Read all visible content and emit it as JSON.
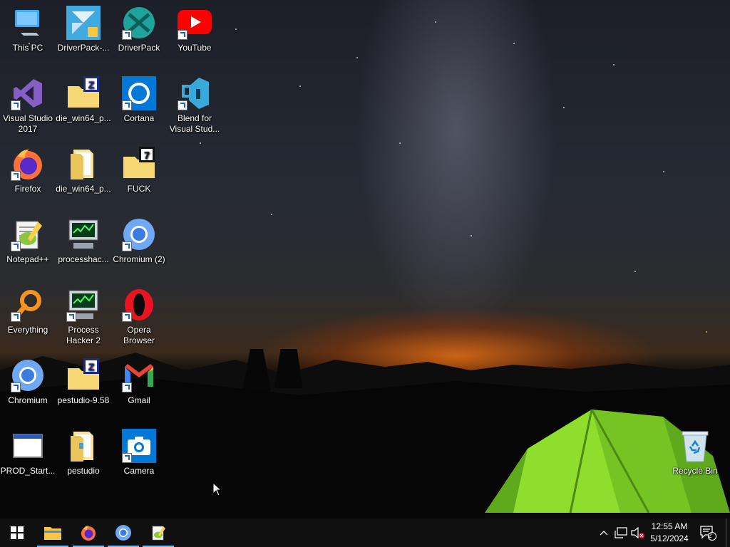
{
  "desktop": {
    "icons": [
      {
        "label": "This PC",
        "icon": "this-pc-icon"
      },
      {
        "label": "DriverPack-...",
        "icon": "driverpack-installer-icon"
      },
      {
        "label": "DriverPack",
        "icon": "driverpack-icon"
      },
      {
        "label": "YouTube",
        "icon": "youtube-icon"
      },
      {
        "label": "Visual Studio 2017",
        "icon": "visual-studio-icon"
      },
      {
        "label": "die_win64_p...",
        "icon": "zip-folder-icon"
      },
      {
        "label": "Cortana",
        "icon": "cortana-icon"
      },
      {
        "label": "Blend for Visual Stud...",
        "icon": "blend-icon"
      },
      {
        "label": "Firefox",
        "icon": "firefox-icon"
      },
      {
        "label": "die_win64_p...",
        "icon": "folder-icon"
      },
      {
        "label": "FUCK",
        "icon": "7zip-folder-icon"
      },
      {
        "label": "Notepad++",
        "icon": "notepad-plus-plus-icon"
      },
      {
        "label": "processhac...",
        "icon": "process-hacker-icon"
      },
      {
        "label": "Chromium (2)",
        "icon": "chromium-icon"
      },
      {
        "label": "Everything",
        "icon": "everything-icon"
      },
      {
        "label": "Process Hacker 2",
        "icon": "process-hacker-icon"
      },
      {
        "label": "Opera Browser",
        "icon": "opera-icon"
      },
      {
        "label": "Chromium",
        "icon": "chromium-icon"
      },
      {
        "label": "pestudio-9.58",
        "icon": "zip-folder-icon"
      },
      {
        "label": "Gmail",
        "icon": "gmail-icon"
      },
      {
        "label": "PROD_Start...",
        "icon": "window-app-icon"
      },
      {
        "label": "pestudio",
        "icon": "folder-icon"
      },
      {
        "label": "Camera",
        "icon": "camera-icon"
      },
      {
        "label": "Recycle Bin",
        "icon": "recycle-bin-icon"
      }
    ]
  },
  "taskbar": {
    "pinned": [
      {
        "name": "start-button",
        "icon": "windows-logo-icon"
      },
      {
        "name": "file-explorer",
        "icon": "file-explorer-icon"
      },
      {
        "name": "firefox",
        "icon": "firefox-icon"
      },
      {
        "name": "chromium",
        "icon": "chromium-icon"
      },
      {
        "name": "notepad-plus-plus",
        "icon": "notepad-plus-plus-icon"
      }
    ],
    "tray": {
      "time": "12:55 AM",
      "date": "5/12/2024",
      "notification_count": "2"
    }
  },
  "colors": {
    "taskbar_bg": "#101010",
    "active_indicator": "#76b9ed",
    "youtube_red": "#ff0000",
    "tent_green": "#7ed321"
  }
}
